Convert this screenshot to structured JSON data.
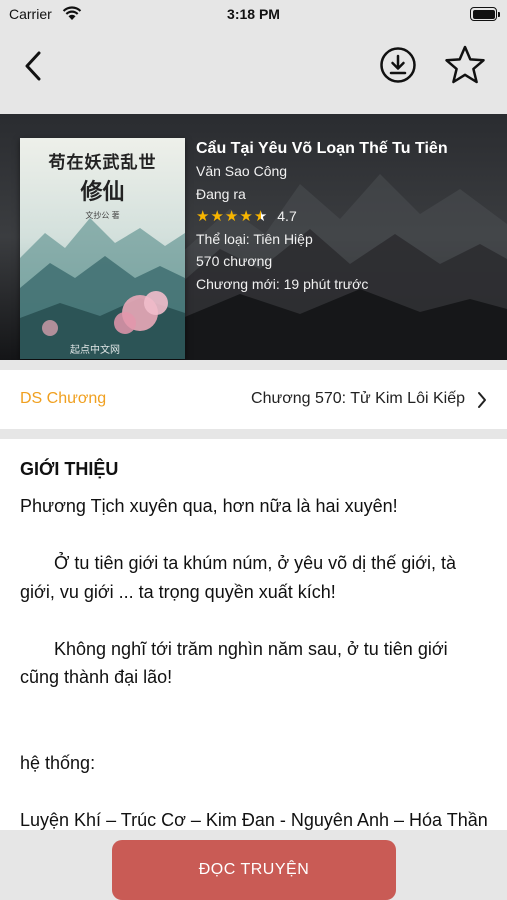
{
  "status_bar": {
    "carrier": "Carrier",
    "time": "3:18 PM"
  },
  "nav": {
    "back_icon": "chevron-left-icon",
    "download_icon": "download-icon",
    "favorite_icon": "star-outline-icon"
  },
  "book": {
    "cover_title_line1": "苟在妖武乱世",
    "cover_title_line2": "修仙",
    "cover_author": "文抄公 著",
    "cover_publisher": "起点中文网",
    "title": "Cẩu Tại Yêu Võ Loạn Thế Tu Tiên",
    "author": "Văn Sao Công",
    "status": "Đang ra",
    "rating": "4.7",
    "rating_stars": 4.5,
    "genre": "Thể loại: Tiên Hiệp",
    "chapter_count": "570 chương",
    "latest_update": "Chương mới: 19 phút trước"
  },
  "chapters": {
    "label": "DS Chương",
    "latest": "Chương 570: Tử Kim Lôi Kiếp"
  },
  "description": {
    "heading": "GIỚI THIỆU",
    "p1": "Phương Tịch xuyên qua, hơn nữa là hai xuyên!",
    "p2": "Ở tu tiên giới ta khúm núm, ở yêu võ dị thế giới, tà giới, vu giới ... ta trọng quyền xuất kích!",
    "p3": "Không nghĩ tới trăm nghìn năm sau, ở tu tiên giới cũng thành đại lão!",
    "p4": "hệ thống:",
    "p5": "Luyện Khí – Trúc Cơ – Kim Đan - Nguyên Anh – Hóa Thần – Phản Hư"
  },
  "actions": {
    "read_label": "ĐỌC TRUYỆN"
  },
  "colors": {
    "accent_orange": "#f0a020",
    "read_button": "#c95b55",
    "star": "#f7b500",
    "bar_gray": "#e6e6e6"
  }
}
